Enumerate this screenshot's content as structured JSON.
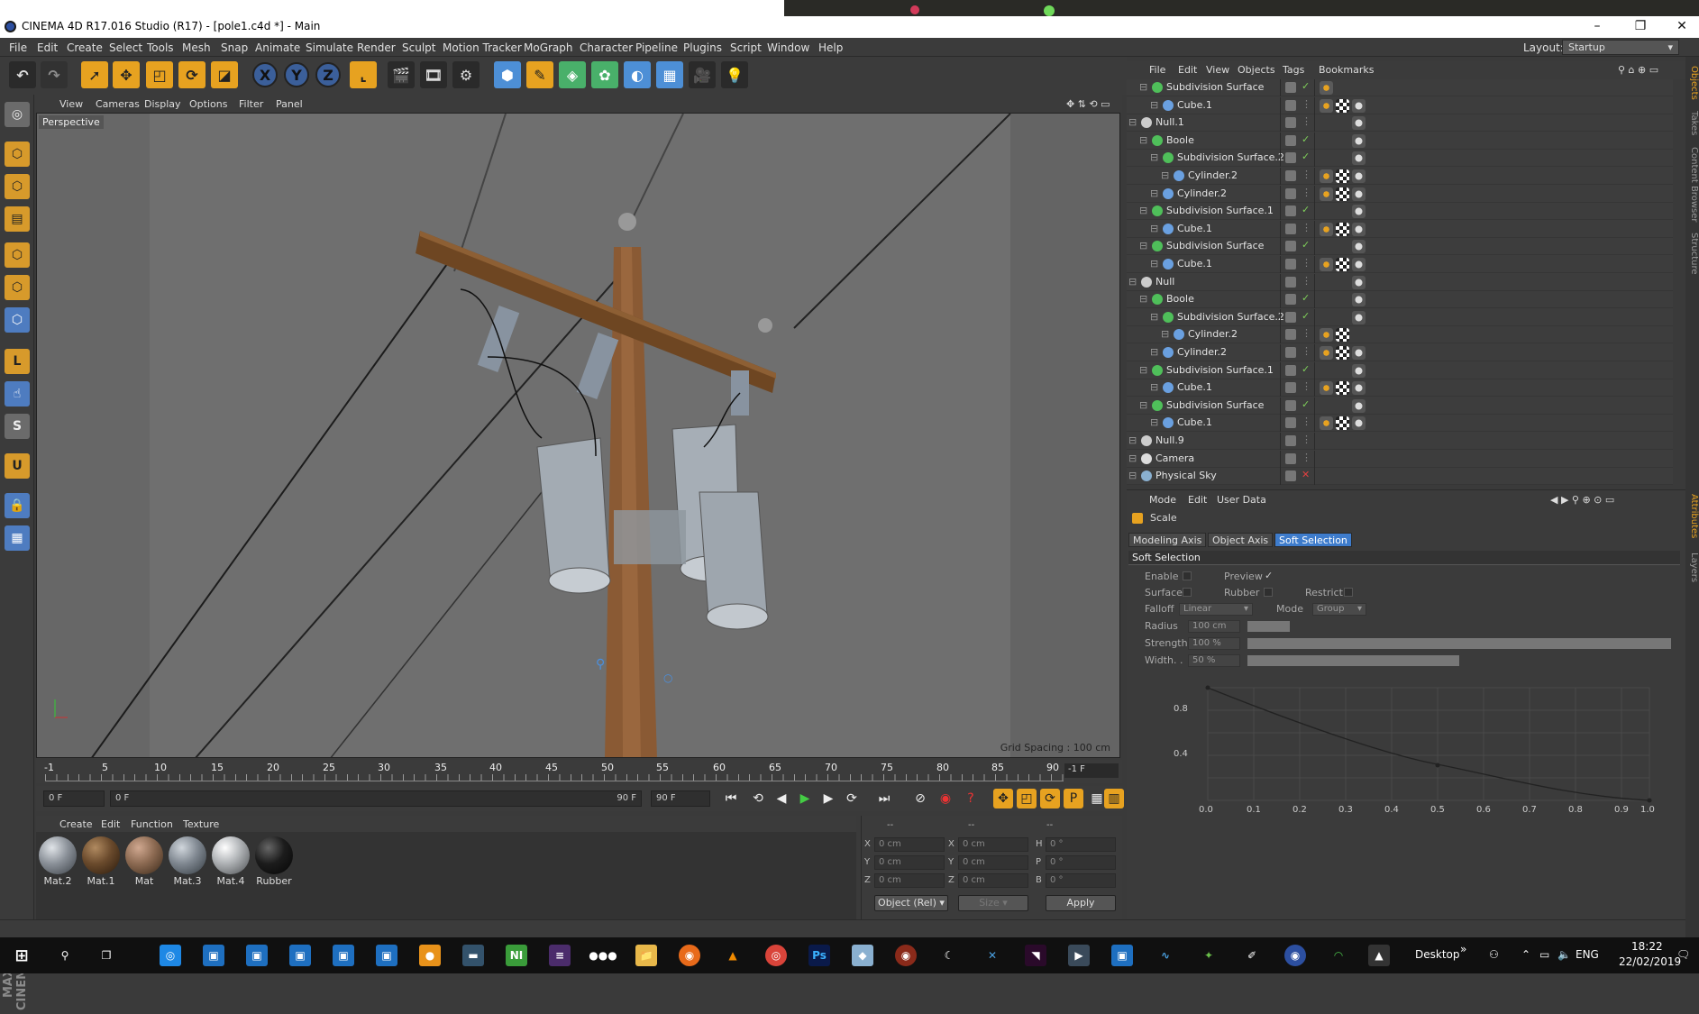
{
  "window": {
    "title": "CINEMA 4D R17.016 Studio (R17) - [pole1.c4d *] - Main",
    "controls": [
      "–",
      "❐",
      "✕"
    ]
  },
  "menu": [
    "File",
    "Edit",
    "Create",
    "Select",
    "Tools",
    "Mesh",
    "Snap",
    "Animate",
    "Simulate",
    "Render",
    "Sculpt",
    "Motion Tracker",
    "MoGraph",
    "Character",
    "Pipeline",
    "Plugins",
    "Script",
    "Window",
    "Help"
  ],
  "layout": {
    "label": "Layout:",
    "value": "Startup"
  },
  "viewport": {
    "menu": [
      "View",
      "Cameras",
      "Display",
      "Options",
      "Filter",
      "Panel"
    ],
    "camera_label": "Perspective",
    "grid_spacing": "Grid Spacing : 100 cm"
  },
  "timeline": {
    "ticks": [
      "-1",
      "5",
      "10",
      "15",
      "20",
      "25",
      "30",
      "35",
      "40",
      "45",
      "50",
      "55",
      "60",
      "65",
      "70",
      "75",
      "80",
      "85",
      "90"
    ],
    "current_frame": "-1 F"
  },
  "transport": {
    "start": "0 F",
    "range_start": "0 F",
    "range_end": "90 F",
    "end": "90 F"
  },
  "materials": {
    "menu": [
      "Create",
      "Edit",
      "Function",
      "Texture"
    ],
    "items": [
      {
        "name": "Mat.2",
        "color": "#8a9098"
      },
      {
        "name": "Mat.1",
        "color": "#6a4a2c"
      },
      {
        "name": "Mat",
        "color": "#8c6a52"
      },
      {
        "name": "Mat.3",
        "color": "#7f8790"
      },
      {
        "name": "Mat.4",
        "color": "#b6b9bc"
      },
      {
        "name": "Rubber",
        "color": "#1c1c1c"
      }
    ]
  },
  "coords": {
    "header": [
      "--",
      "--",
      "--"
    ],
    "rows": [
      {
        "a": "X",
        "av": "0 cm",
        "b": "X",
        "bv": "0 cm",
        "c": "H",
        "cv": "0 °"
      },
      {
        "a": "Y",
        "av": "0 cm",
        "b": "Y",
        "bv": "0 cm",
        "c": "P",
        "cv": "0 °"
      },
      {
        "a": "Z",
        "av": "0 cm",
        "b": "Z",
        "bv": "0 cm",
        "c": "B",
        "cv": "0 °"
      }
    ],
    "mode": "Object (Rel)",
    "size": "Size",
    "apply": "Apply"
  },
  "objects": {
    "menu": [
      "File",
      "Edit",
      "View",
      "Objects",
      "Tags",
      "Bookmarks"
    ],
    "rows": [
      {
        "name": "Subdivision Surface",
        "indent": 1,
        "icon": "#4fbf5a"
      },
      {
        "name": "Cube.1",
        "indent": 2,
        "icon": "#6aa0e0"
      },
      {
        "name": "Null.1",
        "indent": 0,
        "icon": "#cccccc"
      },
      {
        "name": "Boole",
        "indent": 1,
        "icon": "#4fbf5a"
      },
      {
        "name": "Subdivision Surface.2",
        "indent": 2,
        "icon": "#4fbf5a"
      },
      {
        "name": "Cylinder.2",
        "indent": 3,
        "icon": "#6aa0e0"
      },
      {
        "name": "Cylinder.2",
        "indent": 2,
        "icon": "#6aa0e0"
      },
      {
        "name": "Subdivision Surface.1",
        "indent": 1,
        "icon": "#4fbf5a"
      },
      {
        "name": "Cube.1",
        "indent": 2,
        "icon": "#6aa0e0"
      },
      {
        "name": "Subdivision Surface",
        "indent": 1,
        "icon": "#4fbf5a"
      },
      {
        "name": "Cube.1",
        "indent": 2,
        "icon": "#6aa0e0"
      },
      {
        "name": "Null",
        "indent": 0,
        "icon": "#cccccc"
      },
      {
        "name": "Boole",
        "indent": 1,
        "icon": "#4fbf5a"
      },
      {
        "name": "Subdivision Surface.2",
        "indent": 2,
        "icon": "#4fbf5a"
      },
      {
        "name": "Cylinder.2",
        "indent": 3,
        "icon": "#6aa0e0"
      },
      {
        "name": "Cylinder.2",
        "indent": 2,
        "icon": "#6aa0e0"
      },
      {
        "name": "Subdivision Surface.1",
        "indent": 1,
        "icon": "#4fbf5a"
      },
      {
        "name": "Cube.1",
        "indent": 2,
        "icon": "#6aa0e0"
      },
      {
        "name": "Subdivision Surface",
        "indent": 1,
        "icon": "#4fbf5a"
      },
      {
        "name": "Cube.1",
        "indent": 2,
        "icon": "#6aa0e0"
      },
      {
        "name": "Null.9",
        "indent": 0,
        "icon": "#cccccc"
      },
      {
        "name": "Camera",
        "indent": 0,
        "icon": "#dddddd"
      },
      {
        "name": "Physical Sky",
        "indent": 0,
        "icon": "#8ab0d0"
      }
    ]
  },
  "attributes": {
    "menu": [
      "Mode",
      "Edit",
      "User Data"
    ],
    "object": "Scale",
    "tabs": [
      "Modeling Axis",
      "Object Axis",
      "Soft Selection"
    ],
    "active_tab": "Soft Selection",
    "section": "Soft Selection",
    "enable": "Enable",
    "preview": "Preview",
    "surface": "Surface",
    "rubber": "Rubber",
    "restrict": "Restrict",
    "falloff_label": "Falloff",
    "falloff": "Linear",
    "mode_label": "Mode",
    "mode": "Group",
    "radius_label": "Radius",
    "radius": "100 cm",
    "strength_label": "Strength",
    "strength": "100 %",
    "width_label": "Width. .",
    "width": "50 %",
    "graph_y": [
      "0.8",
      "0.4",
      "0.0"
    ],
    "graph_x": [
      "0.1",
      "0.2",
      "0.3",
      "0.4",
      "0.5",
      "0.6",
      "0.7",
      "0.8",
      "0.9",
      "1.0"
    ]
  },
  "right_tabs": [
    "Objects",
    "Takes",
    "Content Browser",
    "Structure",
    "Attributes",
    "Layers"
  ],
  "taskbar": {
    "desktop": "Desktop",
    "lang": "ENG",
    "time": "18:22",
    "date": "22/02/2019"
  }
}
